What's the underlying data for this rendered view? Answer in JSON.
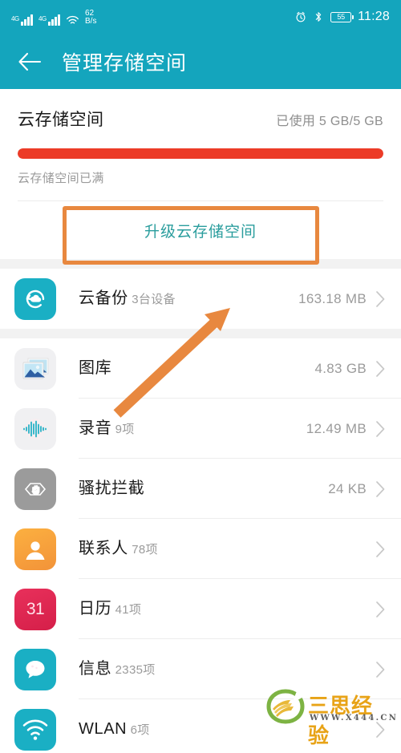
{
  "status_bar": {
    "signal1_label": "4G",
    "signal2_label": "4G",
    "net_speed_value": "62",
    "net_speed_unit": "B/s",
    "battery_level": "55",
    "clock": "11:28"
  },
  "app_bar": {
    "title": "管理存储空间",
    "back_icon": "back-arrow-icon"
  },
  "storage": {
    "title": "云存储空间",
    "used_label": "已使用 5 GB/5 GB",
    "percent": 100,
    "note": "云存储空间已满",
    "upgrade_label": "升级云存储空间"
  },
  "list": [
    {
      "icon": "cloud-backup-icon",
      "title": "云备份",
      "subtitle": "3台设备",
      "value": "163.18 MB"
    },
    {
      "icon": "gallery-icon",
      "title": "图库",
      "subtitle": "",
      "value": "4.83 GB"
    },
    {
      "icon": "recorder-icon",
      "title": "录音",
      "subtitle": "9项",
      "value": "12.49 MB"
    },
    {
      "icon": "block-icon",
      "title": "骚扰拦截",
      "subtitle": "",
      "value": "24 KB"
    },
    {
      "icon": "contacts-icon",
      "title": "联系人",
      "subtitle": "78项",
      "value": ""
    },
    {
      "icon": "calendar-icon",
      "title": "日历",
      "subtitle": "41项",
      "value": "",
      "badge": "31"
    },
    {
      "icon": "messages-icon",
      "title": "信息",
      "subtitle": "2335项",
      "value": ""
    },
    {
      "icon": "wlan-icon",
      "title": "WLAN",
      "subtitle": "6项",
      "value": ""
    }
  ],
  "annotations": {
    "highlight_box_color": "#e8883f",
    "arrow_color": "#e8883f"
  },
  "watermark": {
    "text": "三思经验",
    "url": "WWW.X444.CN"
  },
  "colors": {
    "accent_teal": "#14a5bd",
    "progress_red": "#ec3b27",
    "link_teal": "#2a9d9d"
  }
}
